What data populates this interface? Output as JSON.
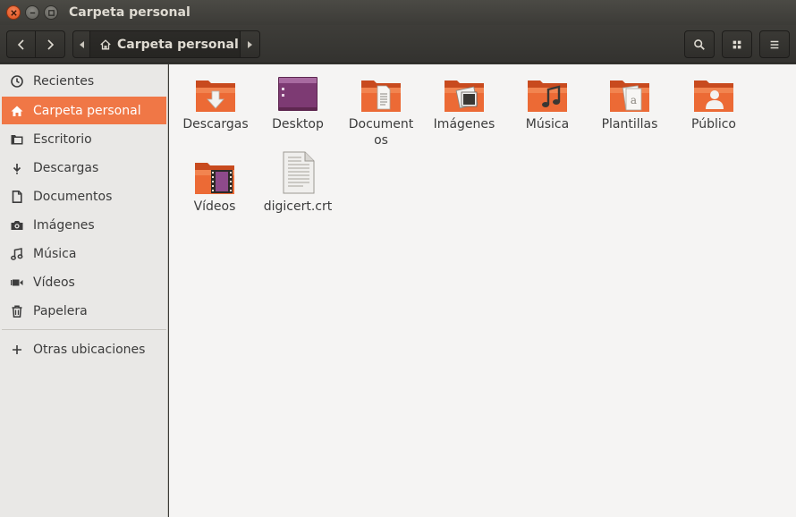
{
  "window": {
    "title": "Carpeta personal"
  },
  "header": {
    "breadcrumb": "Carpeta personal"
  },
  "sidebar": {
    "items": [
      {
        "label": "Recientes",
        "icon": "clock-icon"
      },
      {
        "label": "Carpeta personal",
        "icon": "home-icon",
        "active": true
      },
      {
        "label": "Escritorio",
        "icon": "desktop-folder-icon"
      },
      {
        "label": "Descargas",
        "icon": "download-icon"
      },
      {
        "label": "Documentos",
        "icon": "document-icon"
      },
      {
        "label": "Imágenes",
        "icon": "camera-icon"
      },
      {
        "label": "Música",
        "icon": "music-icon"
      },
      {
        "label": "Vídeos",
        "icon": "video-icon"
      },
      {
        "label": "Papelera",
        "icon": "trash-icon"
      }
    ],
    "other": {
      "label": "Otras ubicaciones",
      "icon": "plus-icon"
    }
  },
  "files": [
    {
      "label": "Descargas",
      "icon": "folder-download-icon"
    },
    {
      "label": "Desktop",
      "icon": "folder-desktop-icon"
    },
    {
      "label": "Documentos",
      "icon": "folder-documents-icon"
    },
    {
      "label": "Imágenes",
      "icon": "folder-pictures-icon"
    },
    {
      "label": "Música",
      "icon": "folder-music-icon"
    },
    {
      "label": "Plantillas",
      "icon": "folder-templates-icon"
    },
    {
      "label": "Público",
      "icon": "folder-public-icon"
    },
    {
      "label": "Vídeos",
      "icon": "folder-videos-icon"
    },
    {
      "label": "digicert.crt",
      "icon": "text-file-icon"
    }
  ],
  "colors": {
    "accent": "#f07746",
    "folder": "#e8612c",
    "titlebar": "#3c3b37"
  }
}
